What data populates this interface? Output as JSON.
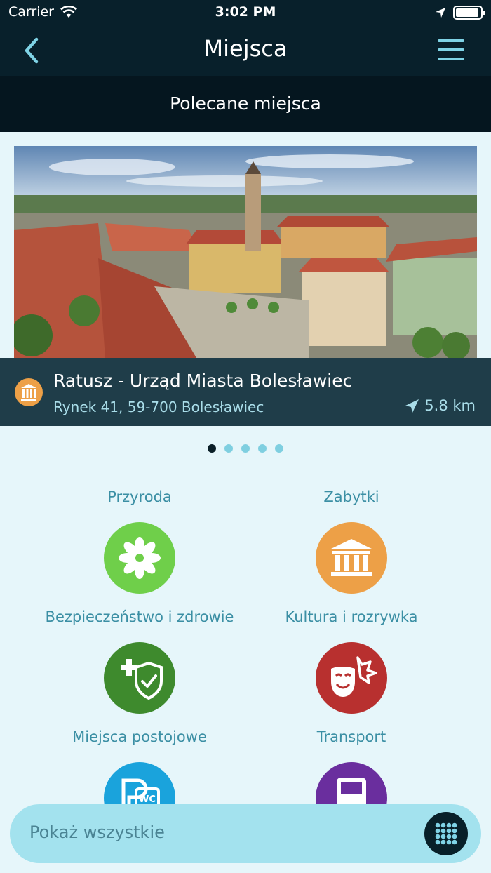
{
  "status_bar": {
    "carrier": "Carrier",
    "time": "3:02 PM"
  },
  "nav": {
    "title": "Miejsca",
    "back_icon": "chevron-left-icon",
    "menu_icon": "hamburger-menu-icon"
  },
  "section": {
    "title": "Polecane miejsca"
  },
  "featured": {
    "name": "Ratusz - Urząd Miasta Bolesławiec",
    "address": "Rynek 41, 59-700 Bolesławiec",
    "distance": "5.8 km",
    "category_icon": "museum-icon",
    "page_count": 5,
    "active_page": 1
  },
  "categories": [
    {
      "label": "Przyroda",
      "icon": "flower-icon",
      "color": "#6fcf4a"
    },
    {
      "label": "Zabytki",
      "icon": "museum-icon",
      "color": "#eda047"
    },
    {
      "label": "Bezpieczeństwo i zdrowie",
      "icon": "medical-shield-icon",
      "color": "#3e8a2d"
    },
    {
      "label": "Kultura i rozrywka",
      "icon": "theater-masks-icon",
      "color": "#b8302f"
    },
    {
      "label": "Miejsca postojowe",
      "icon": "parking-wc-icon",
      "color": "#1aa3dc"
    },
    {
      "label": "Transport",
      "icon": "bus-icon",
      "color": "#6a2e9e"
    }
  ],
  "show_all": {
    "label": "Pokaż wszystkie",
    "icon": "grid-dots-icon"
  },
  "colors": {
    "header_bg": "#08202b",
    "page_bg": "#e6f6fa",
    "accent": "#3b8fa4"
  }
}
